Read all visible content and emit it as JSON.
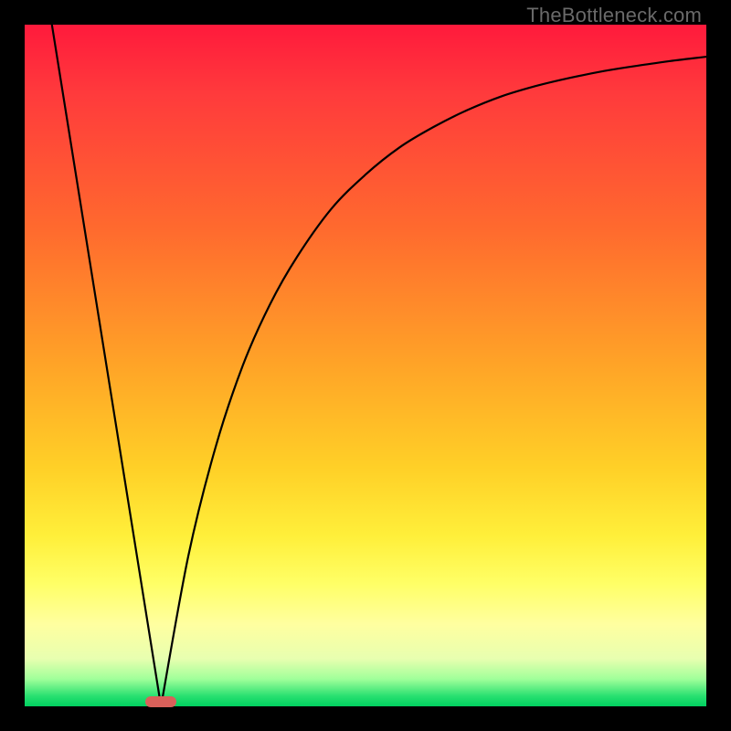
{
  "watermark": "TheBottleneck.com",
  "chart_data": {
    "type": "line",
    "title": "",
    "xlabel": "",
    "ylabel": "",
    "xlim": [
      0,
      1
    ],
    "ylim": [
      0,
      1
    ],
    "minimum_x": 0.2,
    "minimum_marker_color": "#d9605a",
    "series": [
      {
        "name": "left-branch",
        "x": [
          0.04,
          0.2
        ],
        "y": [
          1.0,
          0.0
        ]
      },
      {
        "name": "right-branch",
        "x": [
          0.2,
          0.24,
          0.28,
          0.32,
          0.36,
          0.4,
          0.45,
          0.5,
          0.55,
          0.6,
          0.65,
          0.7,
          0.75,
          0.8,
          0.85,
          0.9,
          0.95,
          1.0
        ],
        "y": [
          0.0,
          0.22,
          0.38,
          0.5,
          0.59,
          0.66,
          0.73,
          0.78,
          0.82,
          0.85,
          0.875,
          0.895,
          0.91,
          0.922,
          0.932,
          0.94,
          0.947,
          0.953
        ]
      }
    ],
    "gradient_stops": [
      {
        "pos": 0.0,
        "color": "#ff1a3c"
      },
      {
        "pos": 0.3,
        "color": "#ff6a2e"
      },
      {
        "pos": 0.65,
        "color": "#ffd027"
      },
      {
        "pos": 0.88,
        "color": "#ffffa0"
      },
      {
        "pos": 1.0,
        "color": "#00d060"
      }
    ]
  }
}
